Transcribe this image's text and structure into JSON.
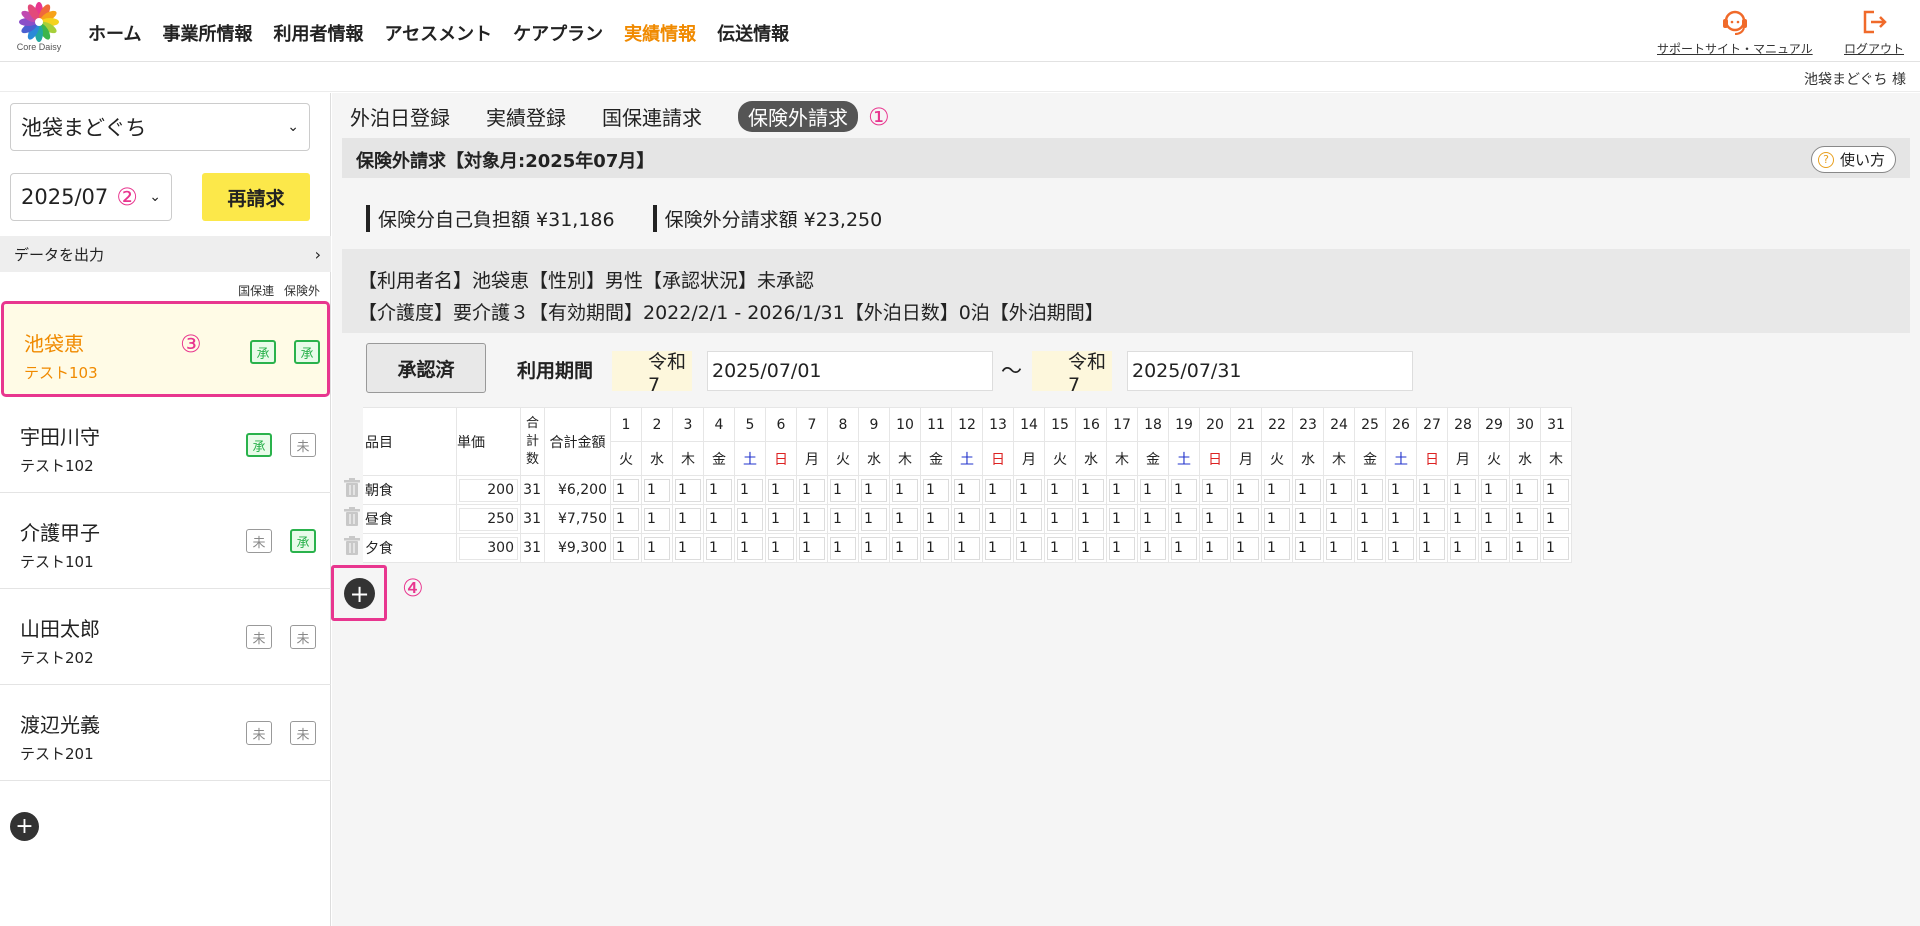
{
  "header": {
    "logo_text": "Core Daisy",
    "nav": [
      {
        "label": "ホーム",
        "active": false
      },
      {
        "label": "事業所情報",
        "active": false
      },
      {
        "label": "利用者情報",
        "active": false
      },
      {
        "label": "アセスメント",
        "active": false
      },
      {
        "label": "ケアプラン",
        "active": false
      },
      {
        "label": "実績情報",
        "active": true
      },
      {
        "label": "伝送情報",
        "active": false
      }
    ],
    "support_label": "サポートサイト・マニュアル",
    "logout_label": "ログアウト",
    "user_label": "池袋まどぐち 様"
  },
  "sidebar": {
    "office": "池袋まどぐち",
    "month": "2025/07",
    "rebill_label": "再請求",
    "export_label": "データを出力",
    "col_kokuho": "国保連",
    "col_hokengai": "保険外",
    "annot_2": "②",
    "annot_3": "③",
    "users": [
      {
        "name": "池袋恵",
        "code": "テスト103",
        "kokuho": "承",
        "hokengai": "承",
        "selected": true
      },
      {
        "name": "宇田川守",
        "code": "テスト102",
        "kokuho": "承",
        "hokengai": "未",
        "selected": false
      },
      {
        "name": "介護甲子",
        "code": "テスト101",
        "kokuho": "未",
        "hokengai": "承",
        "selected": false
      },
      {
        "name": "山田太郎",
        "code": "テスト202",
        "kokuho": "未",
        "hokengai": "未",
        "selected": false
      },
      {
        "name": "渡辺光義",
        "code": "テスト201",
        "kokuho": "未",
        "hokengai": "未",
        "selected": false
      }
    ]
  },
  "main": {
    "tabs": [
      "外泊日登録",
      "実績登録",
      "国保連請求",
      "保険外請求"
    ],
    "annot_1": "①",
    "annot_4": "④",
    "section_title": "保険外請求【対象月:2025年07月】",
    "howto_label": "使い方",
    "insured_total": "保険分自己負担額 ¥31,186",
    "uninsured_total": "保険外分請求額 ¥23,250",
    "info_line1": "【利用者名】池袋恵【性別】男性【承認状況】未承認",
    "info_line2": "【介護度】要介護３【有効期間】2022/2/1 - 2026/1/31【外泊日数】0泊【外泊期間】",
    "approve_label": "承認済",
    "period_label": "利用期間",
    "start_era": "令和7",
    "start_date": "2025/07/01",
    "tilde": "〜",
    "end_era": "令和7",
    "end_date": "2025/07/31"
  },
  "table": {
    "headers": {
      "item": "品目",
      "price": "単価",
      "count": "合計数",
      "amount": "合計金額"
    },
    "weekdays": [
      "火",
      "水",
      "木",
      "金",
      "土",
      "日",
      "月",
      "火",
      "水",
      "木",
      "金",
      "土",
      "日",
      "月",
      "火",
      "水",
      "木",
      "金",
      "土",
      "日",
      "月",
      "火",
      "水",
      "木",
      "金",
      "土",
      "日",
      "月",
      "火",
      "水",
      "木"
    ],
    "rows": [
      {
        "item": "朝食",
        "price": "200",
        "count": "31",
        "amount": "¥6,200",
        "days": [
          "1",
          "1",
          "1",
          "1",
          "1",
          "1",
          "1",
          "1",
          "1",
          "1",
          "1",
          "1",
          "1",
          "1",
          "1",
          "1",
          "1",
          "1",
          "1",
          "1",
          "1",
          "1",
          "1",
          "1",
          "1",
          "1",
          "1",
          "1",
          "1",
          "1",
          "1"
        ]
      },
      {
        "item": "昼食",
        "price": "250",
        "count": "31",
        "amount": "¥7,750",
        "days": [
          "1",
          "1",
          "1",
          "1",
          "1",
          "1",
          "1",
          "1",
          "1",
          "1",
          "1",
          "1",
          "1",
          "1",
          "1",
          "1",
          "1",
          "1",
          "1",
          "1",
          "1",
          "1",
          "1",
          "1",
          "1",
          "1",
          "1",
          "1",
          "1",
          "1",
          "1"
        ]
      },
      {
        "item": "夕食",
        "price": "300",
        "count": "31",
        "amount": "¥9,300",
        "days": [
          "1",
          "1",
          "1",
          "1",
          "1",
          "1",
          "1",
          "1",
          "1",
          "1",
          "1",
          "1",
          "1",
          "1",
          "1",
          "1",
          "1",
          "1",
          "1",
          "1",
          "1",
          "1",
          "1",
          "1",
          "1",
          "1",
          "1",
          "1",
          "1",
          "1",
          "1"
        ]
      }
    ]
  },
  "colors": {
    "accent": "#f08a00",
    "highlight": "#e8368f",
    "approved": "#2ab24c",
    "rebill_bg": "#fce84a"
  },
  "icons": {
    "logo": "daisy-flower-icon",
    "support": "headset-icon",
    "logout": "logout-icon",
    "trash": "trash-icon",
    "add": "plus-icon",
    "help": "question-icon"
  }
}
